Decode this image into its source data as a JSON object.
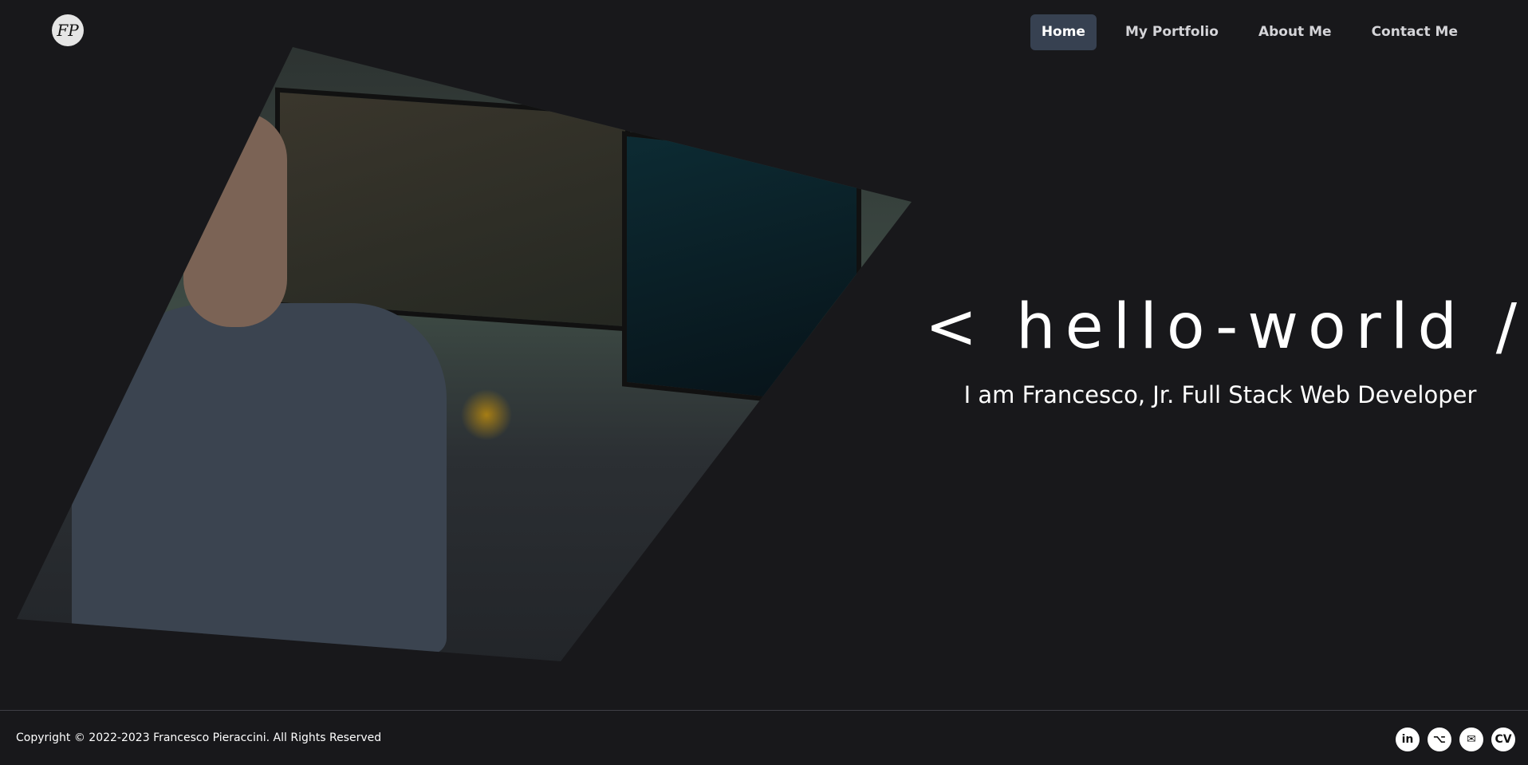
{
  "header": {
    "logo_text": "FP",
    "nav": [
      {
        "label": "Home",
        "active": true
      },
      {
        "label": "My Portfolio"
      },
      {
        "label": "About Me"
      },
      {
        "label": "Contact Me"
      }
    ],
    "active_color": "#374151"
  },
  "hero": {
    "title": "< hello-world />",
    "subtitle": "I am Francesco, Jr. Full Stack Web Developer"
  },
  "footer": {
    "copyright": "Copyright © 2022-2023 Francesco Pieraccini. All Rights Reserved",
    "socials": [
      {
        "icon": "linkedin-icon",
        "label": "in"
      },
      {
        "icon": "github-icon",
        "label": "⌥"
      },
      {
        "icon": "mail-icon",
        "label": "✉"
      },
      {
        "icon": "cv-icon",
        "label": "CV"
      }
    ]
  }
}
